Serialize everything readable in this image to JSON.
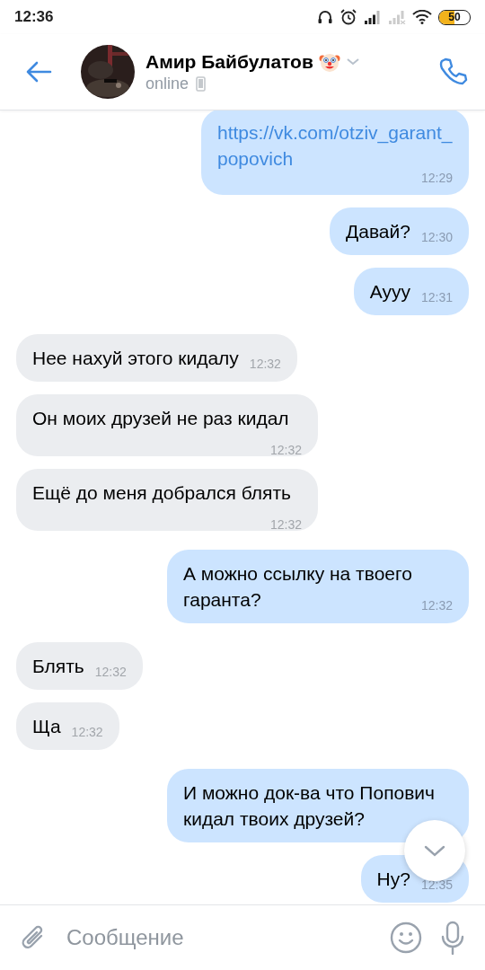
{
  "status_bar": {
    "time": "12:36",
    "battery": "50"
  },
  "header": {
    "name": "Амир Байбулатов",
    "status": "online"
  },
  "messages": [
    {
      "outgoing": true,
      "kind": "link",
      "text": "https://vk.com/otziv_garant_popovich",
      "time": "12:29"
    },
    {
      "outgoing": true,
      "kind": "text",
      "text": "Давай?",
      "time": "12:30"
    },
    {
      "outgoing": true,
      "kind": "text",
      "text": "Аууу",
      "time": "12:31"
    },
    {
      "outgoing": false,
      "kind": "text",
      "text": "Нее нахуй этого кидалу",
      "time": "12:32"
    },
    {
      "outgoing": false,
      "kind": "text",
      "text": "Он моих друзей не раз кидал",
      "time": "12:32"
    },
    {
      "outgoing": false,
      "kind": "text",
      "text": "Ещё до меня добрался блять",
      "time": "12:32"
    },
    {
      "outgoing": true,
      "kind": "text",
      "text": "А можно ссылку на твоего гаранта?",
      "time": "12:32"
    },
    {
      "outgoing": false,
      "kind": "text",
      "text": "Блять",
      "time": "12:32"
    },
    {
      "outgoing": false,
      "kind": "text",
      "text": "Ща",
      "time": "12:32"
    },
    {
      "outgoing": true,
      "kind": "text",
      "text": "И можно док-ва что Попович кидал твоих друзей?"
    },
    {
      "outgoing": true,
      "kind": "text",
      "text": "Ну?",
      "time": "12:35"
    }
  ],
  "composer": {
    "placeholder": "Сообщение"
  }
}
